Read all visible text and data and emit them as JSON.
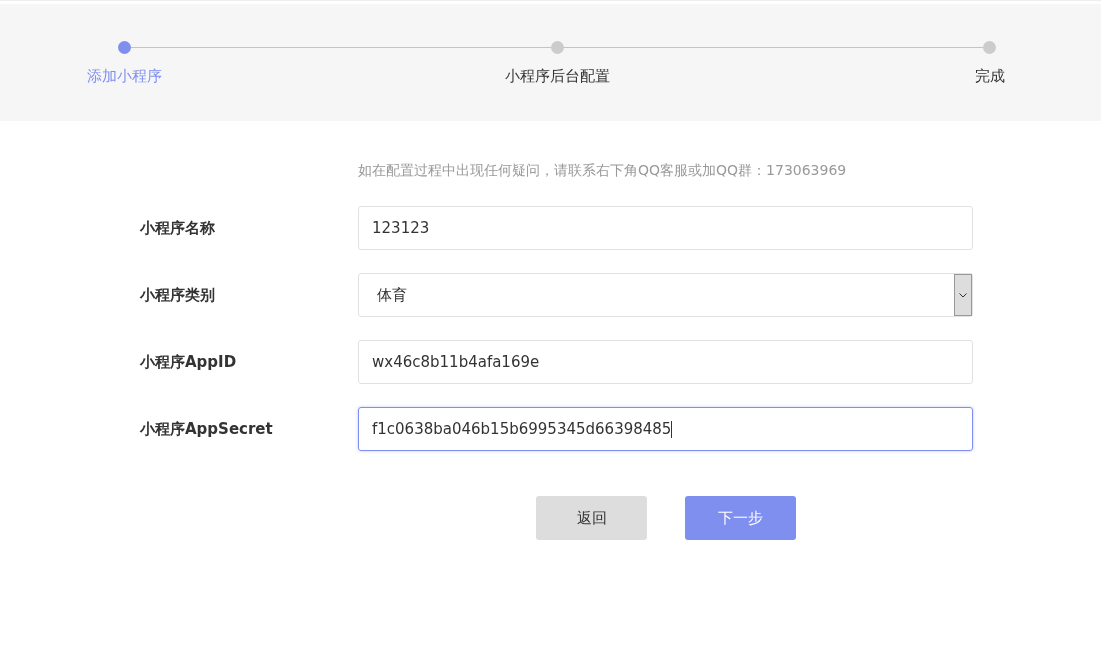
{
  "steps": [
    {
      "label": "添加小程序",
      "selected": true
    },
    {
      "label": "小程序后台配置",
      "selected": false
    },
    {
      "label": "完成",
      "selected": false
    }
  ],
  "hint": "如在配置过程中出现任何疑问，请联系右下角QQ客服或加QQ群：173063969",
  "fields": [
    {
      "kind": "text",
      "label": "小程序名称",
      "value": "123123",
      "focused": false
    },
    {
      "kind": "select",
      "label": "小程序类别",
      "value": "体育",
      "focused": false
    },
    {
      "kind": "text",
      "label": "小程序AppID",
      "value": "wx46c8b11b4afa169e",
      "focused": false
    },
    {
      "kind": "text",
      "label": "小程序AppSecret",
      "value": "f1c0638ba046b15b6995345d66398485",
      "focused": true
    }
  ],
  "buttons": [
    {
      "kind": "secondary",
      "label": "返回"
    },
    {
      "kind": "primary",
      "label": "下一步"
    }
  ]
}
